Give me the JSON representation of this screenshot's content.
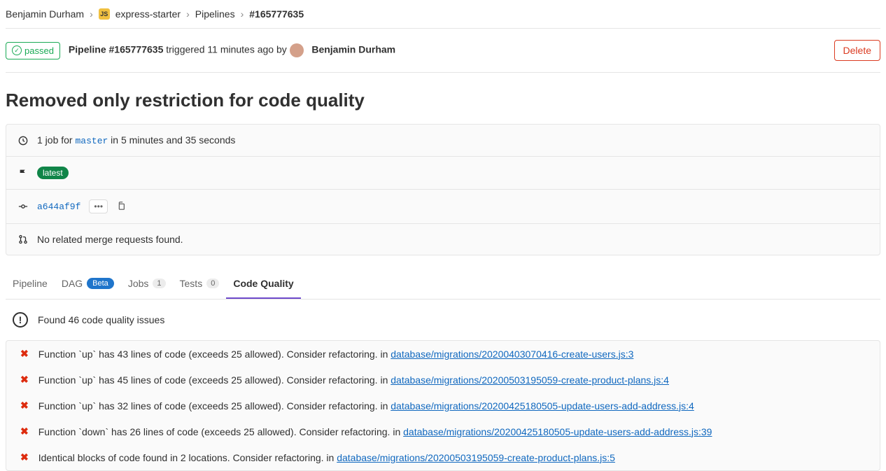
{
  "breadcrumb": {
    "owner": "Benjamin Durham",
    "project_icon": "JS",
    "project": "express-starter",
    "section": "Pipelines",
    "current": "#165777635"
  },
  "header": {
    "status": "passed",
    "pipeline_label": "Pipeline #165777635",
    "triggered_text": " triggered 11 minutes ago by ",
    "user": "Benjamin Durham",
    "delete_label": "Delete"
  },
  "title": "Removed only restriction for code quality",
  "info": {
    "jobs_prefix": "1 job for ",
    "branch": "master",
    "jobs_suffix": " in 5 minutes and 35 seconds",
    "latest_label": "latest",
    "commit_sha": "a644af9f",
    "no_mr": "No related merge requests found."
  },
  "tabs": {
    "pipeline": "Pipeline",
    "dag": "DAG",
    "dag_badge": "Beta",
    "jobs": "Jobs",
    "jobs_count": "1",
    "tests": "Tests",
    "tests_count": "0",
    "code_quality": "Code Quality"
  },
  "summary": "Found 46 code quality issues",
  "issues": [
    {
      "desc": "Function `up` has 43 lines of code (exceeds 25 allowed). Consider refactoring.",
      "path": "database/migrations/20200403070416-create-users.js:3"
    },
    {
      "desc": "Function `up` has 45 lines of code (exceeds 25 allowed). Consider refactoring.",
      "path": "database/migrations/20200503195059-create-product-plans.js:4"
    },
    {
      "desc": "Function `up` has 32 lines of code (exceeds 25 allowed). Consider refactoring.",
      "path": "database/migrations/20200425180505-update-users-add-address.js:4"
    },
    {
      "desc": "Function `down` has 26 lines of code (exceeds 25 allowed). Consider refactoring.",
      "path": "database/migrations/20200425180505-update-users-add-address.js:39"
    },
    {
      "desc": "Identical blocks of code found in 2 locations. Consider refactoring.",
      "path": "database/migrations/20200503195059-create-product-plans.js:5"
    }
  ],
  "in_label": "  in "
}
